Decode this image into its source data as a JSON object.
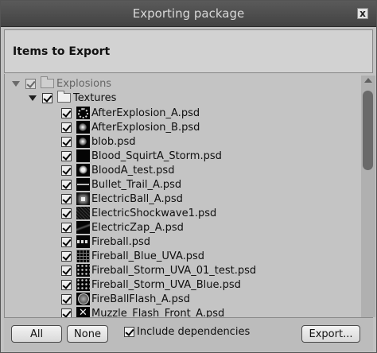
{
  "window": {
    "title": "Exporting package",
    "close_glyph": "x"
  },
  "header": {
    "title": "Items to Export"
  },
  "tree": {
    "root": {
      "label": "Explosions",
      "checked": true,
      "dimmed": true
    },
    "folder": {
      "label": "Textures",
      "checked": true
    },
    "files": [
      {
        "label": "AfterExplosion_A.psd",
        "icon": "ring-thumb-icon",
        "checked": true
      },
      {
        "label": "AfterExplosion_B.psd",
        "icon": "glow-thumb-icon",
        "checked": true
      },
      {
        "label": "blob.psd",
        "icon": "glow-thumb-icon",
        "checked": true
      },
      {
        "label": "Blood_SquirtA_Storm.psd",
        "icon": "black-thumb-icon",
        "checked": true
      },
      {
        "label": "BloodA_test.psd",
        "icon": "splat-thumb-icon",
        "checked": true
      },
      {
        "label": "Bullet_Trail_A.psd",
        "icon": "line-thumb-icon",
        "checked": true
      },
      {
        "label": "ElectricBall_A.psd",
        "icon": "spark-thumb-icon",
        "checked": true
      },
      {
        "label": "ElectricShockwave1.psd",
        "icon": "noise-thumb-icon",
        "checked": true
      },
      {
        "label": "ElectricZap_A.psd",
        "icon": "zap-thumb-icon",
        "checked": true
      },
      {
        "label": "Fireball.psd",
        "icon": "fire-strip-thumb-icon",
        "checked": true
      },
      {
        "label": "Fireball_Blue_UVA.psd",
        "icon": "grid-thumb-icon",
        "checked": true
      },
      {
        "label": "Fireball_Storm_UVA_01_test.psd",
        "icon": "dots-thumb-icon",
        "checked": true
      },
      {
        "label": "Fireball_Storm_UVA_Blue.psd",
        "icon": "dots-thumb-icon",
        "checked": true
      },
      {
        "label": "FireBallFlash_A.psd",
        "icon": "flash-thumb-icon",
        "checked": true
      },
      {
        "label": "Muzzle_Flash_Front_A.psd",
        "icon": "cross-thumb-icon",
        "checked": true
      }
    ]
  },
  "footer": {
    "all_label": "All",
    "none_label": "None",
    "include_dependencies_label": "Include dependencies",
    "include_dependencies_checked": true,
    "export_label": "Export..."
  }
}
